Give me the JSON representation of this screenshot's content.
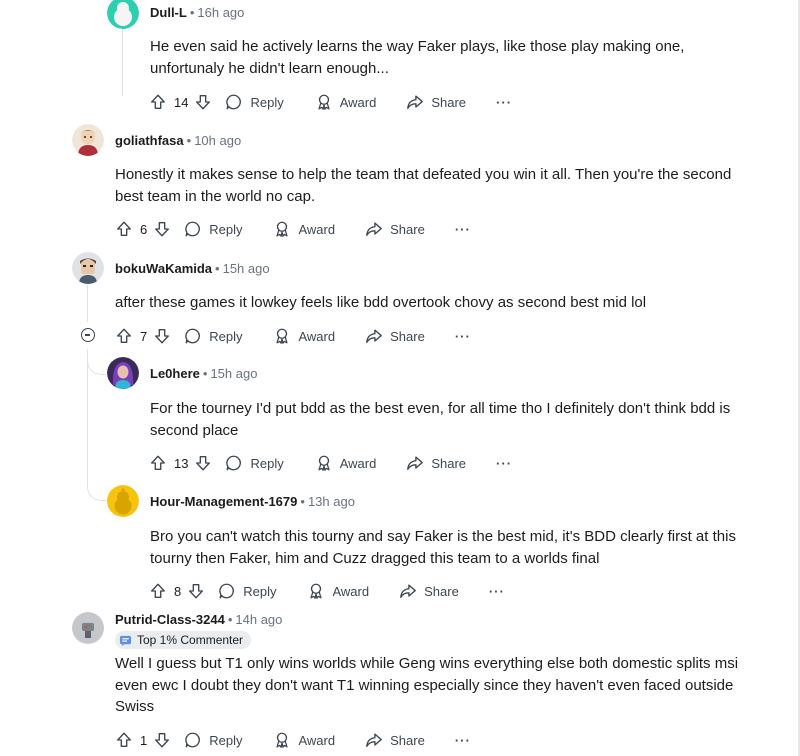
{
  "comments": [
    {
      "author": "Dull-L",
      "time": "16h ago",
      "body": "He even said he actively learns the way Faker plays, like those play making one, unfortunaly he didn't learn enough...",
      "votes": "14",
      "reply_label": "Reply",
      "award_label": "Award",
      "share_label": "Share",
      "more_label": "···",
      "avatar_color": "#2ecfb0"
    },
    {
      "author": "goliathfasa",
      "time": "10h ago",
      "body": "Honestly it makes sense to help the team that defeated you win it all. Then you're the second best team in the world no cap.",
      "votes": "6",
      "reply_label": "Reply",
      "award_label": "Award",
      "share_label": "Share",
      "more_label": "···"
    },
    {
      "author": "bokuWaKamida",
      "time": "15h ago",
      "body": "after these games it lowkey feels like bdd overtook chovy as second best mid lol",
      "votes": "7",
      "reply_label": "Reply",
      "award_label": "Award",
      "share_label": "Share",
      "more_label": "···"
    },
    {
      "author": "Le0here",
      "time": "15h ago",
      "body": "For the tourney I'd put bdd as the best even, for all time tho I definitely don't think bdd is second place",
      "votes": "13",
      "reply_label": "Reply",
      "award_label": "Award",
      "share_label": "Share",
      "more_label": "···"
    },
    {
      "author": "Hour-Management-1679",
      "time": "13h ago",
      "body": "Bro you can't watch this tourny and say Faker is the best mid, it's BDD clearly first at this tourny then Faker, him and Cuzz dragged this team to a worlds final",
      "votes": "8",
      "reply_label": "Reply",
      "award_label": "Award",
      "share_label": "Share",
      "more_label": "···",
      "avatar_color": "#f6c40c"
    },
    {
      "author": "Putrid-Class-3244",
      "time": "14h ago",
      "flair": "Top 1% Commenter",
      "body": "Well I guess but T1 only wins worlds while Geng wins everything else both domestic splits msi even ewc I doubt they don't want T1 winning especially since they haven't even faced outside Swiss",
      "votes": "1",
      "reply_label": "Reply",
      "award_label": "Award",
      "share_label": "Share",
      "more_label": "···"
    }
  ],
  "separator": "•",
  "colors": {
    "text": "#1c1c1c",
    "meta": "#6a7280",
    "thread_line": "#e0e3e6",
    "flair_bg": "#eaedef"
  }
}
